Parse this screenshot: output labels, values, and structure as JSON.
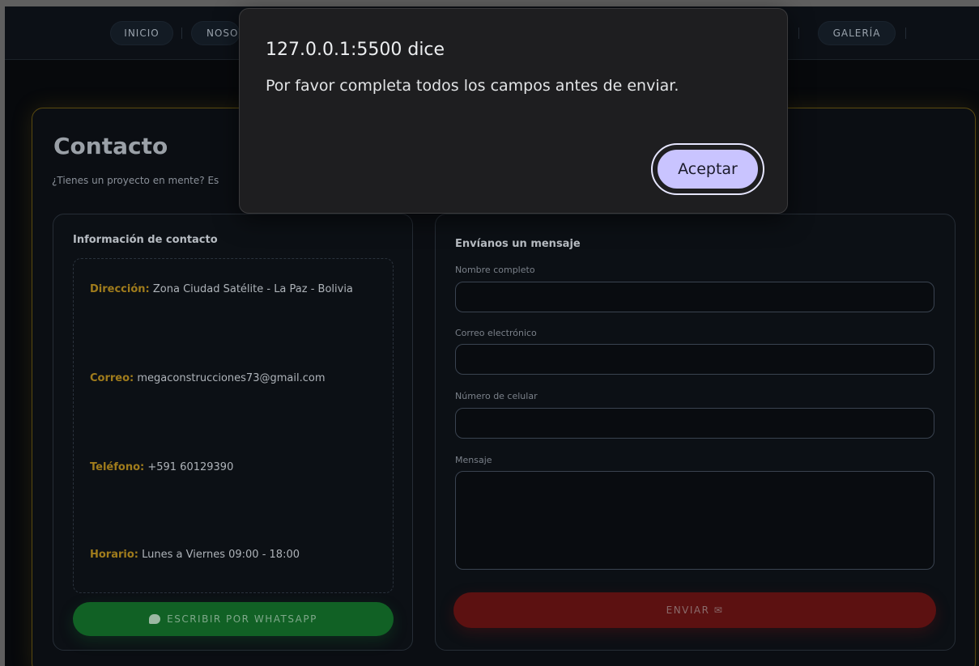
{
  "nav": {
    "items": [
      "INICIO",
      "NOSO",
      "GALERÍA"
    ]
  },
  "contact": {
    "title": "Contacto",
    "subtitle": "¿Tienes un proyecto en mente? Es",
    "info": {
      "heading": "Información de contacto",
      "address_label": "Dirección:",
      "address_value": "Zona Ciudad Satélite - La Paz - Bolivia",
      "email_label": "Correo:",
      "email_value": "megaconstrucciones73@gmail.com",
      "phone_label": "Teléfono:",
      "phone_value": "+591 60129390",
      "hours_label": "Horario:",
      "hours_value": "Lunes a Viernes 09:00 - 18:00",
      "whatsapp_button": "ESCRIBIR POR WHATSAPP"
    },
    "form": {
      "heading": "Envíanos un mensaje",
      "name_label": "Nombre completo",
      "name_value": "",
      "email_label": "Correo electrónico",
      "email_value": "",
      "phone_label": "Número de celular",
      "phone_value": "",
      "message_label": "Mensaje",
      "message_value": "",
      "send_button": "ENVIAR ✉"
    }
  },
  "dialog": {
    "title": "127.0.0.1:5500 dice",
    "message": "Por favor completa todos los campos antes de enviar.",
    "ok_button": "Aceptar"
  },
  "colors": {
    "accent_gold": "#a07c1c",
    "whatsapp_green": "#116125",
    "send_red": "#5c1111",
    "dialog_button": "#c9c4ff"
  }
}
